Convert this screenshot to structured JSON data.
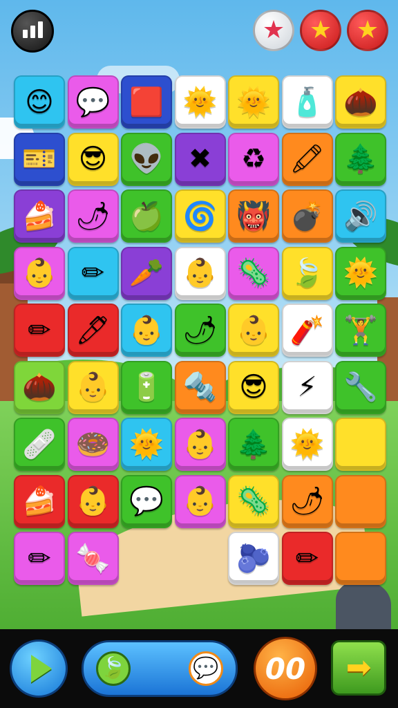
{
  "top": {
    "stats_icon": "bar-chart-icon",
    "stars": [
      {
        "state": "empty",
        "glyph": "★"
      },
      {
        "state": "full",
        "glyph": "★"
      },
      {
        "state": "full",
        "glyph": "★"
      }
    ]
  },
  "colors": {
    "cyan": "#2fc4f0",
    "magenta": "#ea5bea",
    "blue": "#2d4fcf",
    "white": "#ffffff",
    "yellow": "#ffe02a",
    "green": "#3fc22a",
    "orange": "#ff8a1e",
    "purple": "#8a3fd6",
    "red": "#ea2a2a",
    "lime": "#7fd63a"
  },
  "grid": {
    "rows": [
      [
        {
          "color": "cyan",
          "icon": "smiling-face-icon",
          "glyph": "😊"
        },
        {
          "color": "magenta",
          "icon": "speech-bubble-icon",
          "glyph": "💬"
        },
        {
          "color": "blue",
          "icon": "red-card-icon",
          "glyph": "🟥"
        },
        {
          "color": "white",
          "icon": "sun-face-icon",
          "glyph": "🌞"
        },
        {
          "color": "yellow",
          "icon": "sun-face-icon",
          "glyph": "🌞"
        },
        {
          "color": "white",
          "icon": "paint-tube-icon",
          "glyph": "🧴"
        },
        {
          "color": "yellow",
          "icon": "acorn-icon",
          "glyph": "🌰"
        }
      ],
      [
        {
          "color": "blue",
          "icon": "ticket-icon",
          "glyph": "🎫"
        },
        {
          "color": "yellow",
          "icon": "face-with-glasses-icon",
          "glyph": "😎"
        },
        {
          "color": "green",
          "icon": "alien-face-icon",
          "glyph": "👽"
        },
        {
          "color": "purple",
          "icon": "cross-icon",
          "glyph": "✖"
        },
        {
          "color": "magenta",
          "icon": "recycle-icon",
          "glyph": "♻"
        },
        {
          "color": "orange",
          "icon": "crayon-icon",
          "glyph": "🖍"
        },
        {
          "color": "green",
          "icon": "pinecone-stick-icon",
          "glyph": "🌲"
        }
      ],
      [
        {
          "color": "purple",
          "icon": "cake-slice-icon",
          "glyph": "🍰"
        },
        {
          "color": "magenta",
          "icon": "chili-pepper-icon",
          "glyph": "🌶"
        },
        {
          "color": "green",
          "icon": "apple-icon",
          "glyph": "🍏"
        },
        {
          "color": "yellow",
          "icon": "spring-coil-icon",
          "glyph": "🌀"
        },
        {
          "color": "orange",
          "icon": "monster-face-icon",
          "glyph": "👹"
        },
        {
          "color": "orange",
          "icon": "grenade-icon",
          "glyph": "💣"
        },
        {
          "color": "cyan",
          "icon": "speaker-icon",
          "glyph": "🔊"
        }
      ],
      [
        {
          "color": "magenta",
          "icon": "baby-face-icon",
          "glyph": "👶"
        },
        {
          "color": "cyan",
          "icon": "carrot-pencil-icon",
          "glyph": "✏"
        },
        {
          "color": "purple",
          "icon": "carrot-icon",
          "glyph": "🥕"
        },
        {
          "color": "white",
          "icon": "baby-face-icon",
          "glyph": "👶"
        },
        {
          "color": "magenta",
          "icon": "spiky-blob-icon",
          "glyph": "🦠"
        },
        {
          "color": "yellow",
          "icon": "leaf-icon",
          "glyph": "🍃"
        },
        {
          "color": "green",
          "icon": "sun-face-icon",
          "glyph": "🌞"
        }
      ],
      [
        {
          "color": "red",
          "icon": "pencil-icon",
          "glyph": "✏"
        },
        {
          "color": "red",
          "icon": "pencil-icon",
          "glyph": "🖊"
        },
        {
          "color": "cyan",
          "icon": "baby-face-icon",
          "glyph": "👶"
        },
        {
          "color": "green",
          "icon": "chili-pepper-icon",
          "glyph": "🌶"
        },
        {
          "color": "yellow",
          "icon": "baby-face-icon",
          "glyph": "👶"
        },
        {
          "color": "white",
          "icon": "grenade-icon",
          "glyph": "🧨"
        },
        {
          "color": "green",
          "icon": "dumbbell-icon",
          "glyph": "🏋"
        }
      ],
      [
        {
          "color": "lime",
          "icon": "acorn-icon",
          "glyph": "🌰"
        },
        {
          "color": "yellow",
          "icon": "baby-face-icon",
          "glyph": "👶"
        },
        {
          "color": "green",
          "icon": "battery-icon",
          "glyph": "🔋"
        },
        {
          "color": "orange",
          "icon": "screw-pencil-icon",
          "glyph": "🔩"
        },
        {
          "color": "yellow",
          "icon": "face-with-glasses-icon",
          "glyph": "😎"
        },
        {
          "color": "white",
          "icon": "lightning-icon",
          "glyph": "⚡"
        },
        {
          "color": "green",
          "icon": "spring-bar-icon",
          "glyph": "🔧"
        }
      ],
      [
        {
          "color": "green",
          "icon": "bandage-icon",
          "glyph": "🩹"
        },
        {
          "color": "magenta",
          "icon": "donut-icon",
          "glyph": "🍩"
        },
        {
          "color": "cyan",
          "icon": "sun-face-icon",
          "glyph": "🌞"
        },
        {
          "color": "magenta",
          "icon": "baby-face-icon",
          "glyph": "👶"
        },
        {
          "color": "green",
          "icon": "pinecone-stick-icon",
          "glyph": "🌲"
        },
        {
          "color": "white",
          "icon": "sun-face-icon",
          "glyph": "🌞"
        },
        {
          "color": "yellow",
          "icon": "empty-tile",
          "glyph": ""
        }
      ],
      [
        {
          "color": "red",
          "icon": "cake-slice-icon",
          "glyph": "🍰"
        },
        {
          "color": "red",
          "icon": "baby-face-icon",
          "glyph": "👶"
        },
        {
          "color": "green",
          "icon": "speech-bubble-icon",
          "glyph": "💬"
        },
        {
          "color": "magenta",
          "icon": "baby-face-icon",
          "glyph": "👶"
        },
        {
          "color": "yellow",
          "icon": "spiky-blob-icon",
          "glyph": "🦠"
        },
        {
          "color": "orange",
          "icon": "chili-pepper-icon",
          "glyph": "🌶"
        },
        {
          "color": "orange",
          "icon": "empty-tile",
          "glyph": ""
        }
      ],
      [
        {
          "color": "magenta",
          "icon": "pencil-icon",
          "glyph": "✏"
        },
        {
          "color": "magenta",
          "icon": "candy-icon",
          "glyph": "🍬"
        },
        null,
        null,
        {
          "color": "white",
          "icon": "radish-icon",
          "glyph": "🫐"
        },
        {
          "color": "red",
          "icon": "pencil-icon",
          "glyph": "✏"
        },
        {
          "color": "orange",
          "icon": "empty-tile",
          "glyph": ""
        }
      ]
    ]
  },
  "bottom": {
    "play_icon": "play-icon",
    "pill_left_icon": "leaf-icon",
    "pill_left_glyph": "🍃",
    "pill_right_icon": "speech-bubble-icon",
    "pill_right_glyph": "💬",
    "timer_text": "00",
    "next_icon": "arrow-right-icon",
    "next_glyph": "➡"
  }
}
